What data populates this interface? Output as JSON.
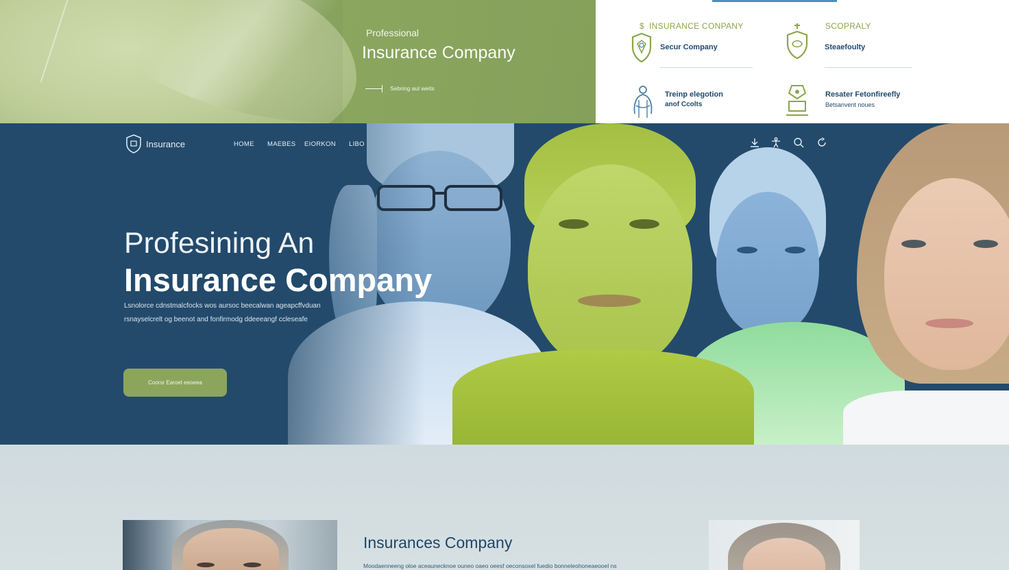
{
  "banner": {
    "eyebrow": "Professional",
    "title": "Insurance Company",
    "link": "Sebring aul weits"
  },
  "features": {
    "label_left": "INSURANCE CONPANY",
    "label_left_prefix": "$",
    "label_right": "SCOPRALY",
    "cards": [
      {
        "title": "Secur Company",
        "sub": ""
      },
      {
        "title": "Steaefoulty",
        "sub": ""
      },
      {
        "title": "Treinp elegotion",
        "title_line2": "anof Ccolts",
        "sub": ""
      },
      {
        "title": "Resater Fetonfireefly",
        "sub": "Betsanvent noues"
      }
    ]
  },
  "header": {
    "logo_text": "Insurance",
    "nav": [
      "HOME",
      "MAEBES",
      "EIORKON",
      "LIBO"
    ],
    "icons": [
      "download-icon",
      "accessibility-icon",
      "search-icon",
      "refresh-icon"
    ]
  },
  "hero": {
    "heading_line1": "Profesining An",
    "heading_line2": "Insurance Company",
    "paragraph_line1": "Lsnolorce cdnstmalcfocks wos aursoc beecalwan ageapcffvduan",
    "paragraph_line2": "rsnayselcrelt og beenot and fonfirmodg ddeeeangf ccleseafe",
    "cta_label": "Coorsr Earoet eeoeea"
  },
  "section": {
    "title": "Insurances Company",
    "text": "Moodaenneeng oloe aceaunecknoe ouneo oaeo oeesf oeconsoxel fuedio bonneleohoneaeooel ns"
  },
  "colors": {
    "hero_bg": "#234a6b",
    "accent_green": "#8ca55d",
    "label_green": "#8aa649",
    "navy_text": "#224a6e"
  }
}
